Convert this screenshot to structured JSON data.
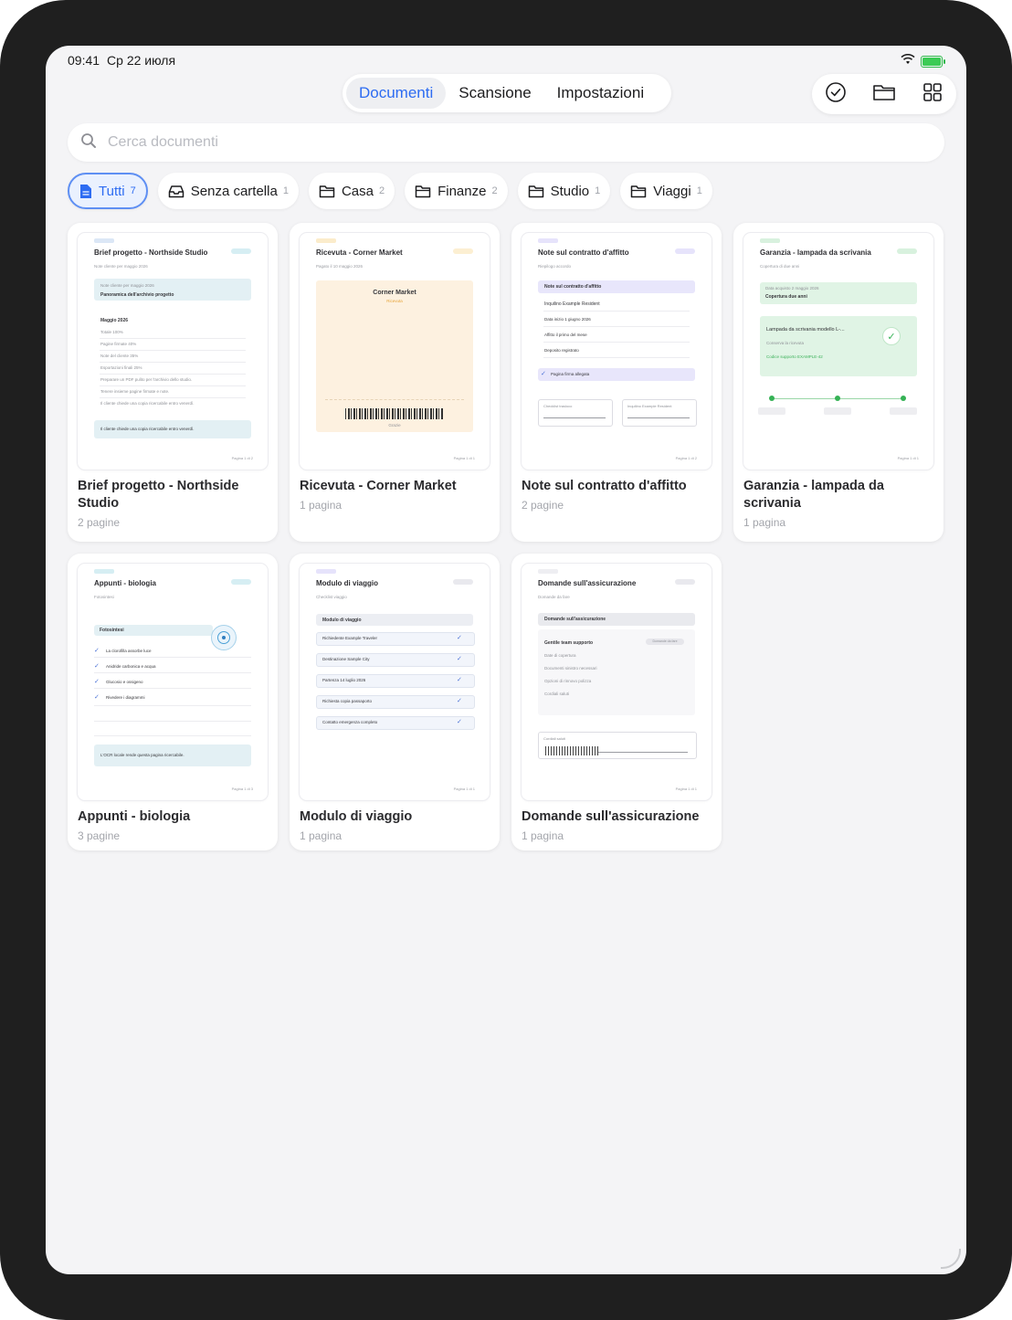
{
  "status": {
    "time": "09:41",
    "date": "Ср 22 июля"
  },
  "nav": {
    "tabs": [
      {
        "label": "Documenti"
      },
      {
        "label": "Scansione"
      },
      {
        "label": "Impostazioni"
      }
    ]
  },
  "search": {
    "placeholder": "Cerca documenti"
  },
  "filters": [
    {
      "label": "Tutti",
      "count": "7",
      "icon": "document-icon"
    },
    {
      "label": "Senza cartella",
      "count": "1",
      "icon": "inbox-icon"
    },
    {
      "label": "Casa",
      "count": "2",
      "icon": "folder-icon"
    },
    {
      "label": "Finanze",
      "count": "2",
      "icon": "folder-icon"
    },
    {
      "label": "Studio",
      "count": "1",
      "icon": "folder-icon"
    },
    {
      "label": "Viaggi",
      "count": "1",
      "icon": "folder-icon"
    }
  ],
  "documents": [
    {
      "name": "Brief progetto - Northside Studio",
      "pages": "2 pagine",
      "thumb": {
        "tag": "BRIEF",
        "title": "Brief progetto - Northside Studio",
        "pill": "OCR",
        "subtitle": "Note cliente per maggio 2026",
        "box_small": "Note cliente per maggio 2026",
        "box_bold": "Panoramica dell'archivio progetto",
        "section": "Maggio 2026",
        "rows": [
          "Totale 100%",
          "Pagine firmate 40%",
          "Note del cliente 35%",
          "Esportazioni finali 25%",
          "Preparare un PDF pulito per l'archivio dello studio.",
          "Tenere insieme pagine firmate e note.",
          "Il cliente chiede una copia ricercabile entro venerdì."
        ],
        "note": "Il cliente chiede una copia ricercabile entro venerdì.",
        "footer": "Pagina 1 di 2"
      }
    },
    {
      "name": "Ricevuta - Corner Market",
      "pages": "1 pagina",
      "thumb": {
        "tag": "RICEVUTE",
        "title": "Ricevuta - Corner Market",
        "pill": "OCR",
        "subtitle": "Pagato il 10 maggio 2026",
        "receipt_title": "Corner Market",
        "receipt_sub": "Ricevuta",
        "receipt_foot": "Grazie",
        "footer": "Pagina 1 di 1"
      }
    },
    {
      "name": "Note sul contratto d'affitto",
      "pages": "2 pagine",
      "thumb": {
        "tag": "DOCUMENTI",
        "title": "Note sul contratto d'affitto",
        "pill": "OCR",
        "subtitle": "Riepilogo accordo",
        "header_row": "Note sul contratto d'affitto",
        "rows": [
          "Inquilino Example Resident",
          "Data inizio 1 giugno 2026",
          "Affitto il primo del mese",
          "Deposito registrato"
        ],
        "check_row": "Pagina firma allegata",
        "sig_left": "Checklist trasloco",
        "sig_right": "Inquilino Example Resident",
        "footer": "Pagina 1 di 2"
      }
    },
    {
      "name": "Garanzia - lampada da scrivania",
      "pages": "1 pagina",
      "thumb": {
        "tag": "GARANZIA",
        "title": "Garanzia - lampada da scrivania",
        "pill": "OCR",
        "subtitle": "Copertura di due anni",
        "box_small": "Data acquisto 2 maggio 2026",
        "box_bold": "Copertura due anni",
        "product": "Lampada da scrivania modello L-...",
        "product_sub": "Conserva la ricevuta",
        "product_code": "Codice supporto EXAMPLE-42",
        "footer": "Pagina 1 di 1"
      }
    },
    {
      "name": "Appunti - biologia",
      "pages": "3 pagine",
      "thumb": {
        "tag": "NOTE",
        "title": "Appunti - biologia",
        "pill": "OCR",
        "subtitle": "Fotosintesi",
        "header_row": "Fotosintesi",
        "rows": [
          "La clorofilla assorbe luce",
          "Anidride carbonica e acqua",
          "Glucosio e ossigeno",
          "Rivedere i diagrammi"
        ],
        "note": "L'OCR locale rende questa pagina ricercabile.",
        "footer": "Pagina 1 di 3"
      }
    },
    {
      "name": "Modulo di viaggio",
      "pages": "1 pagina",
      "thumb": {
        "tag": "MODULI",
        "title": "Modulo di viaggio",
        "pill": "OCR",
        "subtitle": "Checklist viaggio",
        "header_row": "Modulo di viaggio",
        "rows": [
          "Richiedente Example Traveler",
          "Destinazione Sample City",
          "Partenza 14 luglio 2026",
          "Richiesta copia passaporto",
          "Contatto emergenza completo"
        ],
        "footer": "Pagina 1 di 1"
      }
    },
    {
      "name": "Domande sull'assicurazione",
      "pages": "1 pagina",
      "thumb": {
        "tag": "LETTERA",
        "title": "Domande sull'assicurazione",
        "pill": "OCR",
        "subtitle": "Domande da fare",
        "header_row": "Domande sull'assicurazione",
        "bold_row": "Gentile team supporto",
        "badge": "Domande da fare",
        "rows": [
          "Date di copertura",
          "Documenti sinistro necessari",
          "Opzioni di rinnovo polizza",
          "Cordiali saluti"
        ],
        "sig": "Cordiali saluti",
        "footer": "Pagina 1 di 1"
      }
    }
  ],
  "colors": {
    "accent": "#2d6cf2",
    "background": "#f4f4f6",
    "bezel": "#1f1f1f"
  }
}
